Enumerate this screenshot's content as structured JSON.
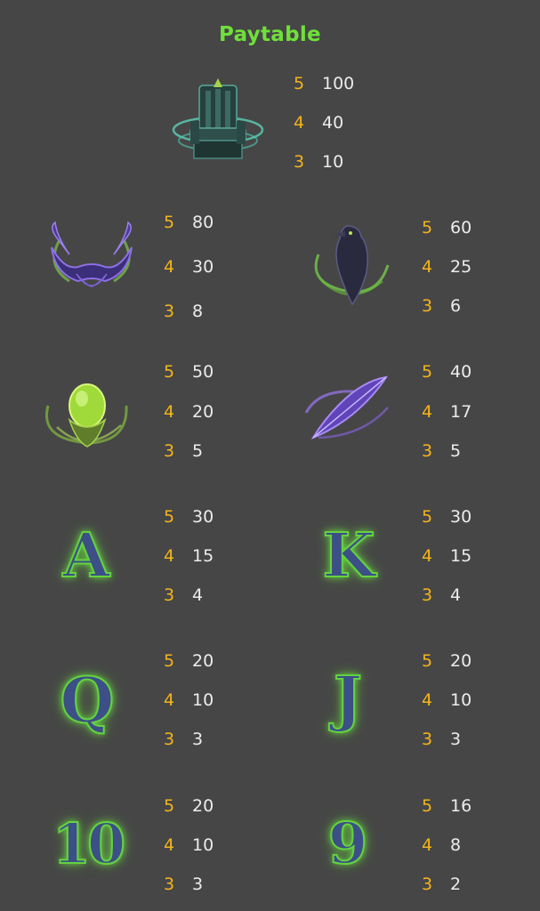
{
  "title": "Paytable",
  "colors": {
    "background": "#464646",
    "title": "#6fe03a",
    "count": "#f4b41a",
    "amount": "#ececec"
  },
  "symbols": [
    {
      "id": "throne",
      "icon": "throne-icon",
      "pays": [
        {
          "count": "5",
          "amount": "100"
        },
        {
          "count": "4",
          "amount": "40"
        },
        {
          "count": "3",
          "amount": "10"
        }
      ]
    },
    {
      "id": "horns",
      "icon": "horns-icon",
      "pays": [
        {
          "count": "5",
          "amount": "80"
        },
        {
          "count": "4",
          "amount": "30"
        },
        {
          "count": "3",
          "amount": "8"
        }
      ]
    },
    {
      "id": "raven",
      "icon": "raven-icon",
      "pays": [
        {
          "count": "5",
          "amount": "60"
        },
        {
          "count": "4",
          "amount": "25"
        },
        {
          "count": "3",
          "amount": "6"
        }
      ]
    },
    {
      "id": "orb",
      "icon": "orb-icon",
      "pays": [
        {
          "count": "5",
          "amount": "50"
        },
        {
          "count": "4",
          "amount": "20"
        },
        {
          "count": "3",
          "amount": "5"
        }
      ]
    },
    {
      "id": "feather",
      "icon": "feather-icon",
      "pays": [
        {
          "count": "5",
          "amount": "40"
        },
        {
          "count": "4",
          "amount": "17"
        },
        {
          "count": "3",
          "amount": "5"
        }
      ]
    },
    {
      "id": "a",
      "glyph": "A",
      "pays": [
        {
          "count": "5",
          "amount": "30"
        },
        {
          "count": "4",
          "amount": "15"
        },
        {
          "count": "3",
          "amount": "4"
        }
      ]
    },
    {
      "id": "k",
      "glyph": "K",
      "pays": [
        {
          "count": "5",
          "amount": "30"
        },
        {
          "count": "4",
          "amount": "15"
        },
        {
          "count": "3",
          "amount": "4"
        }
      ]
    },
    {
      "id": "q",
      "glyph": "Q",
      "pays": [
        {
          "count": "5",
          "amount": "20"
        },
        {
          "count": "4",
          "amount": "10"
        },
        {
          "count": "3",
          "amount": "3"
        }
      ]
    },
    {
      "id": "j",
      "glyph": "J",
      "pays": [
        {
          "count": "5",
          "amount": "20"
        },
        {
          "count": "4",
          "amount": "10"
        },
        {
          "count": "3",
          "amount": "3"
        }
      ]
    },
    {
      "id": "ten",
      "glyph": "10",
      "pays": [
        {
          "count": "5",
          "amount": "20"
        },
        {
          "count": "4",
          "amount": "10"
        },
        {
          "count": "3",
          "amount": "3"
        }
      ]
    },
    {
      "id": "nine",
      "glyph": "9",
      "pays": [
        {
          "count": "5",
          "amount": "16"
        },
        {
          "count": "4",
          "amount": "8"
        },
        {
          "count": "3",
          "amount": "2"
        }
      ]
    }
  ]
}
